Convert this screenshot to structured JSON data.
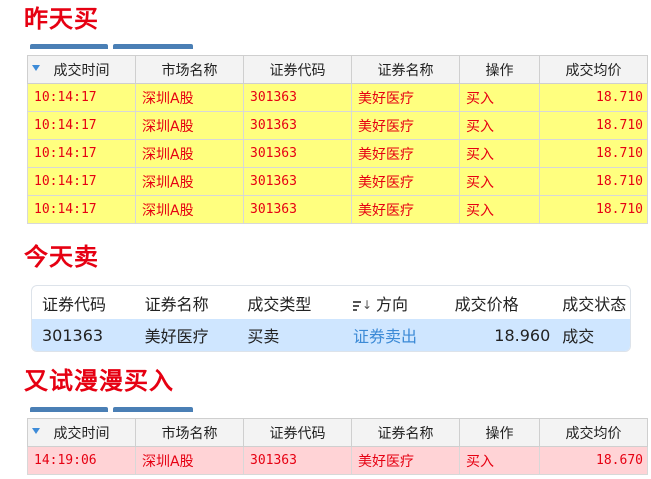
{
  "sections": {
    "buy_yesterday": {
      "title": "昨天买"
    },
    "sell_today": {
      "title": "今天卖"
    },
    "buy_again": {
      "title": "又试漫漫买入"
    }
  },
  "trade_table": {
    "columns": [
      "成交时间",
      "市场名称",
      "证券代码",
      "证券名称",
      "操作",
      "成交均价"
    ],
    "rows": [
      [
        "10:14:17",
        "深圳A股",
        "301363",
        "美好医疗",
        "买入",
        "18.710"
      ],
      [
        "10:14:17",
        "深圳A股",
        "301363",
        "美好医疗",
        "买入",
        "18.710"
      ],
      [
        "10:14:17",
        "深圳A股",
        "301363",
        "美好医疗",
        "买入",
        "18.710"
      ],
      [
        "10:14:17",
        "深圳A股",
        "301363",
        "美好医疗",
        "买入",
        "18.710"
      ],
      [
        "10:14:17",
        "深圳A股",
        "301363",
        "美好医疗",
        "买入",
        "18.710"
      ]
    ],
    "row_color": "#ffff7f",
    "text_color": "#e60012"
  },
  "sell_panel": {
    "columns": [
      "证券代码",
      "证券名称",
      "成交类型",
      "方向",
      "成交价格",
      "成交状态"
    ],
    "row": [
      "301363",
      "美好医疗",
      "买卖",
      "证券卖出",
      "18.960",
      "成交"
    ],
    "sort_icon": "sort-descending-icon",
    "highlight_color": "#cfe6ff"
  },
  "rebuy_table": {
    "columns": [
      "成交时间",
      "市场名称",
      "证券代码",
      "证券名称",
      "操作",
      "成交均价"
    ],
    "rows": [
      [
        "14:19:06",
        "深圳A股",
        "301363",
        "美好医疗",
        "买入",
        "18.670"
      ]
    ],
    "row_color": "#ffd3d6"
  },
  "colors": {
    "heading": "#e60012",
    "tab_accent": "#4a7fb5"
  }
}
